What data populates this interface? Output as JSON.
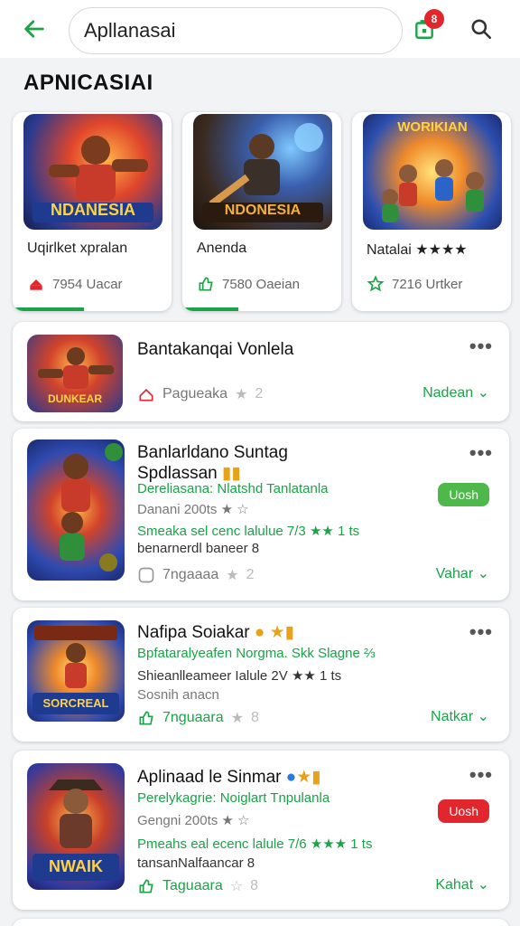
{
  "header": {
    "search_value": "Apllanasai",
    "notif_count": "8"
  },
  "section": {
    "title": "APNICASIAI"
  },
  "featured": [
    {
      "name": "Uqirlket xpralan",
      "stat": "7954 Uacar",
      "stat_icon": "download-icon",
      "accent": "#e2262e",
      "thumb_text": "NDANESIA",
      "progress": 0.45
    },
    {
      "name": "Anenda",
      "stat": "7580 Oaeian",
      "stat_icon": "thumbs-up-icon",
      "accent": "#1aa347",
      "thumb_text": "NDONESIA",
      "progress": 0.35
    },
    {
      "name": "Natalai ★★★★",
      "stat": "7216 Urtker",
      "stat_icon": "star-outline-icon",
      "accent": "#1aa347",
      "thumb_text": "WORIKIAN",
      "progress": 0
    }
  ],
  "list": [
    {
      "title": "Bantakanqai Vonlela",
      "title2": "",
      "lines": [],
      "foot_left": "Pagueaka",
      "foot_num": "2",
      "foot_right": "Nadean ⌄",
      "thumb_text": "DUNKEAR"
    },
    {
      "title": "Banlarldano Suntag",
      "title2": "Spdlassan",
      "pill": "Uosh",
      "pill_color": "#4fb84b",
      "lines": [
        {
          "text": "Dereliasana: Nlatshd Tanlatanla",
          "cls": "green"
        },
        {
          "text": "Danani 200ts  ★  ☆",
          "cls": "grey"
        },
        {
          "text": "Smeaka sel cenc lalulue 7/3 ★★ 1 ts",
          "cls": "green"
        },
        {
          "text": "benarnerdl baneer  8",
          "cls": "dark"
        }
      ],
      "foot_left": "7ngaaaa",
      "foot_num": "2",
      "foot_right": "Vahar ⌄",
      "thumb_text": ""
    },
    {
      "title": "Nafipa Soiakar",
      "title2": "",
      "lines": [
        {
          "text": "Bpfataralyeafen Norgma. Skk Slagne ⅔",
          "cls": "green"
        },
        {
          "text": "Shieanlleameer Ialule 2V ★★ 1 ts",
          "cls": "dark"
        },
        {
          "text": "Sosnih anacn",
          "cls": "grey"
        }
      ],
      "foot_left": "7nguaara",
      "foot_num": "8",
      "foot_right": "Natkar ⌄",
      "thumb_text": "SORCREAL"
    },
    {
      "title": "Aplinaad le Sinmar",
      "title2": "",
      "pill": "Uosh",
      "pill_color": "#e2262e",
      "lines": [
        {
          "text": "Perelykagrie: Noiglart Tnpulanla",
          "cls": "green"
        },
        {
          "text": "Gengni 200ts  ★  ☆",
          "cls": "grey"
        },
        {
          "text": "Pmeahs eal ecenc lalule 7/6 ★★★ 1 ts",
          "cls": "green"
        },
        {
          "text": "tansanNalfaancar  8",
          "cls": "dark"
        }
      ],
      "foot_left": "Taguaara",
      "foot_num": "8",
      "foot_right": "Kahat ⌄",
      "thumb_text": "NWAIK"
    }
  ],
  "colors": {
    "brand_green": "#1aa347",
    "badge_red": "#e2262e"
  }
}
